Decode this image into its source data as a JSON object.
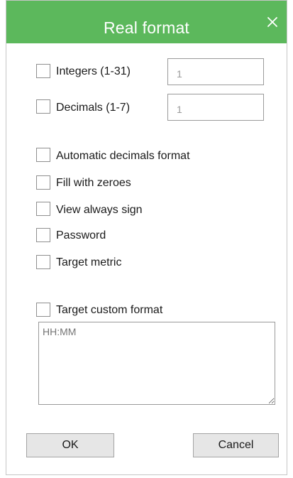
{
  "dialog": {
    "title": "Real format",
    "close_icon": "close-icon",
    "title_bar_color": "#5cb85c"
  },
  "integers": {
    "label": "Integers (1-31)",
    "value": "1",
    "checked": false
  },
  "decimals": {
    "label": "Decimals (1-7)",
    "value": "1",
    "checked": false
  },
  "options": [
    {
      "label": "Automatic decimals format",
      "checked": false
    },
    {
      "label": "Fill with zeroes",
      "checked": false
    },
    {
      "label": "View always sign",
      "checked": false
    },
    {
      "label": "Password",
      "checked": false
    },
    {
      "label": "Target metric",
      "checked": false
    }
  ],
  "custom_format": {
    "label": "Target custom format",
    "checked": false,
    "placeholder": "HH:MM"
  },
  "buttons": {
    "ok": "OK",
    "cancel": "Cancel"
  }
}
